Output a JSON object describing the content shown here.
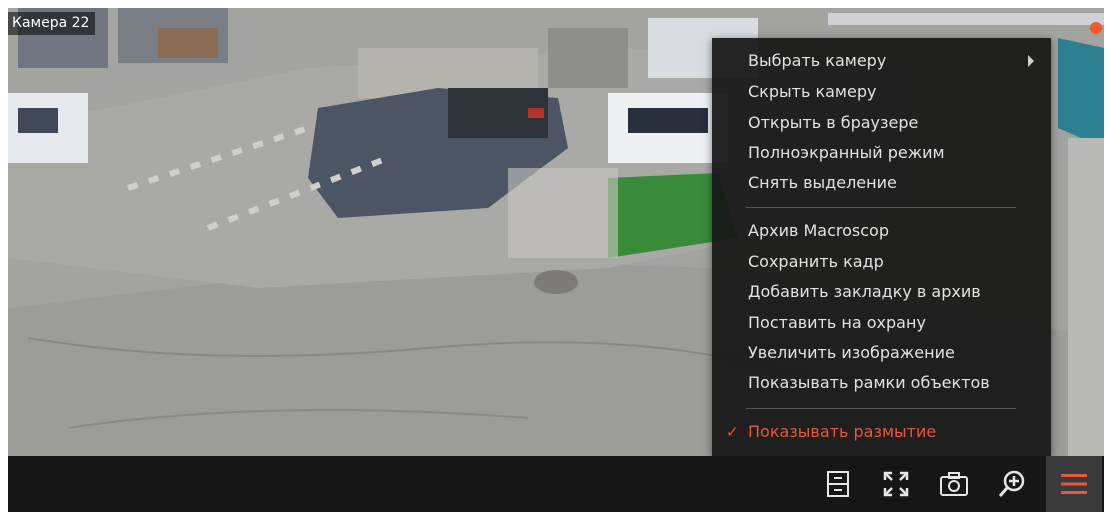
{
  "camera": {
    "title": "Камера 22"
  },
  "context_menu": {
    "group1": [
      {
        "label": "Выбрать камеру",
        "has_submenu": true
      },
      {
        "label": "Скрыть камеру"
      },
      {
        "label": "Открыть в браузере"
      },
      {
        "label": "Полноэкранный режим"
      },
      {
        "label": "Снять выделение"
      }
    ],
    "group2": [
      {
        "label": "Архив Macroscop"
      },
      {
        "label": "Сохранить кадр"
      },
      {
        "label": "Добавить закладку в архив"
      },
      {
        "label": "Поставить на охрану"
      },
      {
        "label": "Увеличить изображение"
      },
      {
        "label": "Показывать рамки объектов"
      }
    ],
    "group3": [
      {
        "label": "Показывать размытие",
        "checked": true
      }
    ]
  },
  "toolbar": {
    "buttons": [
      {
        "icon": "archive-icon"
      },
      {
        "icon": "fullscreen-icon"
      },
      {
        "icon": "camera-snapshot-icon"
      },
      {
        "icon": "zoom-in-icon"
      },
      {
        "icon": "hamburger-menu-icon"
      }
    ]
  },
  "colors": {
    "accent": "#e7573c",
    "menu_bg": "#161616",
    "toolbar_bg": "#161616",
    "menu_text": "#e2e2e2"
  }
}
